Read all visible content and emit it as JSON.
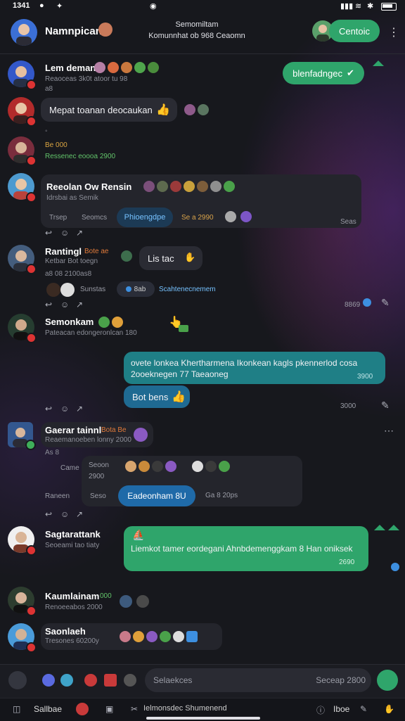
{
  "status": {
    "time": "1341"
  },
  "header": {
    "channel_name": "Namnpican",
    "subtitle_1": "Semomiltam",
    "subtitle_2": "Komunnhat ob 968 Ceaomn",
    "action_label": "Centoic"
  },
  "messages": [
    {
      "name": "Lem deman",
      "meta": "Reaoceas 3k0t atoor tu 98",
      "meta2": "a8"
    },
    {
      "bubble": "Mepat toanan deocaukan"
    },
    {
      "meta": "Be 000",
      "meta2": "Ressenec eoooa 2900"
    },
    {
      "name": "Reeolan Ow Rensin",
      "meta": "Idrsbai as Semik",
      "chips": [
        "Trsep",
        "Seomcs",
        "Phioengdpe",
        "Se a 2990"
      ],
      "time": "Seas"
    },
    {
      "name": "Rantingl",
      "tag": "Bote ae",
      "meta": "Ketbar Bot toegn",
      "meta2": "a8 08 2100as8",
      "bubble": "Lis tac",
      "label1": "Sunstas",
      "label2": "8ab",
      "label3": "Scahtenecnemem",
      "time": "8869"
    },
    {
      "name": "Semonkam",
      "meta": "Pateacan edongeronlcan 180"
    },
    {
      "bubble": "ovete lonkea Khertharmena Ikonkean kagls pkennerlod cosa 2ooeknegen 77 Taeaoneg",
      "time": "3900",
      "chip": "Bot bens"
    },
    {
      "time": "3000"
    },
    {
      "name": "Gaerar tainnl",
      "tag": "Bota Be",
      "meta": "Reaemanoeben lonny 2000",
      "meta2": "As 8",
      "chip1": "Came",
      "chip2": "Seoon",
      "chip3": "2900",
      "chip4": "Raneen",
      "chip5": "Seso",
      "btn": "Eadeonham 8U",
      "chip6": "Ga 8 20ps"
    },
    {
      "name": "Sagtarattank",
      "meta": "Seoeami tao tiaty",
      "bubble": "Liemkot tamer eordegani Ahnbdemenggkam 8 Han oniksek",
      "time": "2690"
    },
    {
      "name": "Kaumlainam",
      "tag": "000",
      "meta": "Renoeeabos 2000"
    },
    {
      "name": "Saonlaeh",
      "meta": "Tresones 60200y"
    }
  ],
  "right_bubble": "blenfadngec",
  "input": {
    "placeholder": "Selaekces",
    "right": "Seceap 2800"
  },
  "navbar": {
    "item1": "Sallbae",
    "item2": "Ielmonsdec Shumenend",
    "item3": "Iboe"
  },
  "colors": {
    "green": "#2fa56b",
    "teal": "#1f7f86",
    "blue": "#1f6aa8",
    "badge": "#d33333"
  }
}
